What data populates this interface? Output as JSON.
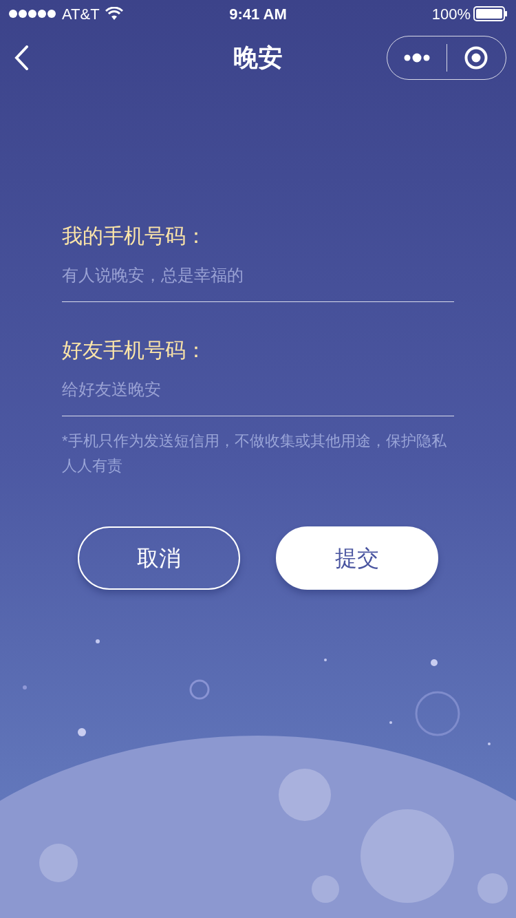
{
  "status_bar": {
    "carrier": "AT&T",
    "time": "9:41 AM",
    "battery": "100%"
  },
  "nav": {
    "title": "晚安"
  },
  "fields": [
    {
      "label": "我的手机号码：",
      "placeholder": "有人说晚安，总是幸福的"
    },
    {
      "label": "好友手机号码：",
      "placeholder": "给好友送晚安"
    }
  ],
  "note": "*手机只作为发送短信用，不做收集或其他用途，保护隐私人人有责",
  "buttons": [
    {
      "label": "取消",
      "kind": "outline"
    },
    {
      "label": "提交",
      "kind": "filled"
    }
  ]
}
